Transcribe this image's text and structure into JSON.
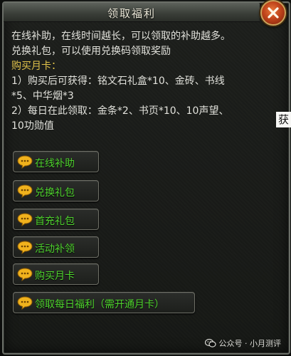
{
  "title": "领取福利",
  "description": {
    "line1": "在线补助，在线时间越长，可以领取的补助越多。",
    "line2": "兑换礼包，可以使用兑换码领取奖励",
    "section_heading": "购买月卡：",
    "item1_line1": "1）购买后可获得：铭文石礼盒*10、金砖、书线",
    "item1_line2": "*5、中华烟*3",
    "item2_line1": "2）每日在此领取：金条*2、书页*10、10声望、",
    "item2_line2": "10功勋值"
  },
  "side_glyph": "获",
  "buttons": [
    {
      "label": "在线补助"
    },
    {
      "label": "兑换礼包"
    },
    {
      "label": "首充礼包"
    },
    {
      "label": "活动补领"
    },
    {
      "label": "购买月卡"
    },
    {
      "label": "领取每日福利（需开通月卡）"
    }
  ],
  "watermark": "公众号 · 小月测评",
  "icons": {
    "close": "close-icon",
    "bubble": "chat-bubble-icon",
    "watermark": "wechat-icon"
  },
  "colors": {
    "button_text": "#4fd32e",
    "heading_gold": "#e0c24a",
    "body_text": "#e2e2dc",
    "close_button": "#c0441b"
  }
}
